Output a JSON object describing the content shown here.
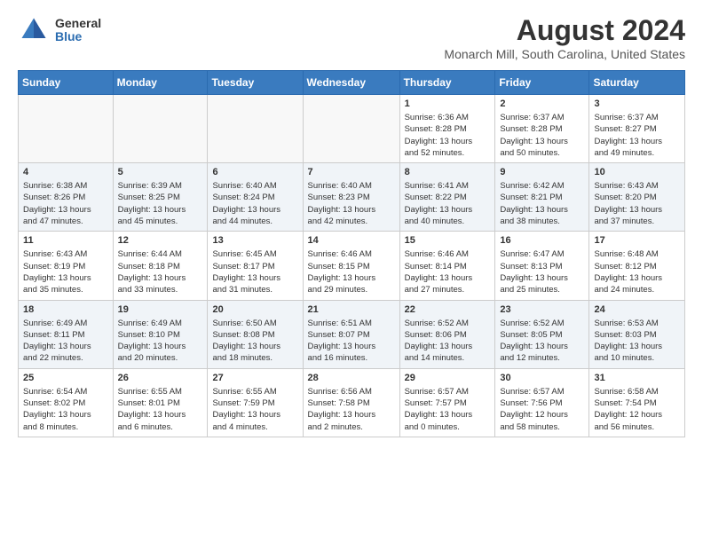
{
  "header": {
    "logo_general": "General",
    "logo_blue": "Blue",
    "month": "August 2024",
    "location": "Monarch Mill, South Carolina, United States"
  },
  "weekdays": [
    "Sunday",
    "Monday",
    "Tuesday",
    "Wednesday",
    "Thursday",
    "Friday",
    "Saturday"
  ],
  "weeks": [
    [
      {
        "day": "",
        "info": ""
      },
      {
        "day": "",
        "info": ""
      },
      {
        "day": "",
        "info": ""
      },
      {
        "day": "",
        "info": ""
      },
      {
        "day": "1",
        "info": "Sunrise: 6:36 AM\nSunset: 8:28 PM\nDaylight: 13 hours\nand 52 minutes."
      },
      {
        "day": "2",
        "info": "Sunrise: 6:37 AM\nSunset: 8:28 PM\nDaylight: 13 hours\nand 50 minutes."
      },
      {
        "day": "3",
        "info": "Sunrise: 6:37 AM\nSunset: 8:27 PM\nDaylight: 13 hours\nand 49 minutes."
      }
    ],
    [
      {
        "day": "4",
        "info": "Sunrise: 6:38 AM\nSunset: 8:26 PM\nDaylight: 13 hours\nand 47 minutes."
      },
      {
        "day": "5",
        "info": "Sunrise: 6:39 AM\nSunset: 8:25 PM\nDaylight: 13 hours\nand 45 minutes."
      },
      {
        "day": "6",
        "info": "Sunrise: 6:40 AM\nSunset: 8:24 PM\nDaylight: 13 hours\nand 44 minutes."
      },
      {
        "day": "7",
        "info": "Sunrise: 6:40 AM\nSunset: 8:23 PM\nDaylight: 13 hours\nand 42 minutes."
      },
      {
        "day": "8",
        "info": "Sunrise: 6:41 AM\nSunset: 8:22 PM\nDaylight: 13 hours\nand 40 minutes."
      },
      {
        "day": "9",
        "info": "Sunrise: 6:42 AM\nSunset: 8:21 PM\nDaylight: 13 hours\nand 38 minutes."
      },
      {
        "day": "10",
        "info": "Sunrise: 6:43 AM\nSunset: 8:20 PM\nDaylight: 13 hours\nand 37 minutes."
      }
    ],
    [
      {
        "day": "11",
        "info": "Sunrise: 6:43 AM\nSunset: 8:19 PM\nDaylight: 13 hours\nand 35 minutes."
      },
      {
        "day": "12",
        "info": "Sunrise: 6:44 AM\nSunset: 8:18 PM\nDaylight: 13 hours\nand 33 minutes."
      },
      {
        "day": "13",
        "info": "Sunrise: 6:45 AM\nSunset: 8:17 PM\nDaylight: 13 hours\nand 31 minutes."
      },
      {
        "day": "14",
        "info": "Sunrise: 6:46 AM\nSunset: 8:15 PM\nDaylight: 13 hours\nand 29 minutes."
      },
      {
        "day": "15",
        "info": "Sunrise: 6:46 AM\nSunset: 8:14 PM\nDaylight: 13 hours\nand 27 minutes."
      },
      {
        "day": "16",
        "info": "Sunrise: 6:47 AM\nSunset: 8:13 PM\nDaylight: 13 hours\nand 25 minutes."
      },
      {
        "day": "17",
        "info": "Sunrise: 6:48 AM\nSunset: 8:12 PM\nDaylight: 13 hours\nand 24 minutes."
      }
    ],
    [
      {
        "day": "18",
        "info": "Sunrise: 6:49 AM\nSunset: 8:11 PM\nDaylight: 13 hours\nand 22 minutes."
      },
      {
        "day": "19",
        "info": "Sunrise: 6:49 AM\nSunset: 8:10 PM\nDaylight: 13 hours\nand 20 minutes."
      },
      {
        "day": "20",
        "info": "Sunrise: 6:50 AM\nSunset: 8:08 PM\nDaylight: 13 hours\nand 18 minutes."
      },
      {
        "day": "21",
        "info": "Sunrise: 6:51 AM\nSunset: 8:07 PM\nDaylight: 13 hours\nand 16 minutes."
      },
      {
        "day": "22",
        "info": "Sunrise: 6:52 AM\nSunset: 8:06 PM\nDaylight: 13 hours\nand 14 minutes."
      },
      {
        "day": "23",
        "info": "Sunrise: 6:52 AM\nSunset: 8:05 PM\nDaylight: 13 hours\nand 12 minutes."
      },
      {
        "day": "24",
        "info": "Sunrise: 6:53 AM\nSunset: 8:03 PM\nDaylight: 13 hours\nand 10 minutes."
      }
    ],
    [
      {
        "day": "25",
        "info": "Sunrise: 6:54 AM\nSunset: 8:02 PM\nDaylight: 13 hours\nand 8 minutes."
      },
      {
        "day": "26",
        "info": "Sunrise: 6:55 AM\nSunset: 8:01 PM\nDaylight: 13 hours\nand 6 minutes."
      },
      {
        "day": "27",
        "info": "Sunrise: 6:55 AM\nSunset: 7:59 PM\nDaylight: 13 hours\nand 4 minutes."
      },
      {
        "day": "28",
        "info": "Sunrise: 6:56 AM\nSunset: 7:58 PM\nDaylight: 13 hours\nand 2 minutes."
      },
      {
        "day": "29",
        "info": "Sunrise: 6:57 AM\nSunset: 7:57 PM\nDaylight: 13 hours\nand 0 minutes."
      },
      {
        "day": "30",
        "info": "Sunrise: 6:57 AM\nSunset: 7:56 PM\nDaylight: 12 hours\nand 58 minutes."
      },
      {
        "day": "31",
        "info": "Sunrise: 6:58 AM\nSunset: 7:54 PM\nDaylight: 12 hours\nand 56 minutes."
      }
    ]
  ]
}
